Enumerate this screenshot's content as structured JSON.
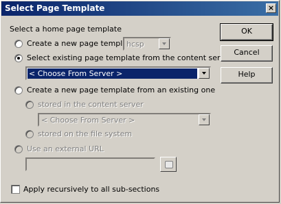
{
  "window": {
    "title": "Select Page Template",
    "close_glyph": "×"
  },
  "section_label": "Select a home page template",
  "options": {
    "create_new": {
      "label": "Create a new page template",
      "combo_value": "hcsp"
    },
    "select_existing": {
      "label": "Select existing page template from the content server",
      "combo_value": "< Choose From Server >"
    },
    "create_from_existing": {
      "label": "Create a new page template from an existing one"
    },
    "stored_in_server": {
      "label": "stored in the content server",
      "combo_value": "< Choose From Server >"
    },
    "stored_on_fs": {
      "label": "stored on the file system"
    },
    "external_url": {
      "label": "Use an external URL",
      "value": ""
    }
  },
  "apply_recursive": {
    "label": "Apply recursively to all sub-sections",
    "checked": false
  },
  "buttons": {
    "ok": "OK",
    "cancel": "Cancel",
    "help": "Help"
  }
}
